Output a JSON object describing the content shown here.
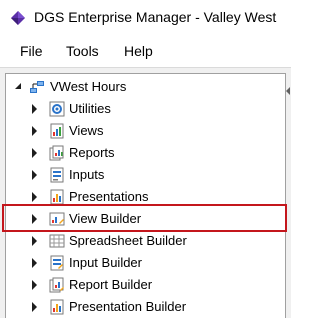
{
  "window": {
    "title": "DGS Enterprise Manager - Valley West",
    "app_icon": "dgs-diamond-logo-icon"
  },
  "menubar": {
    "items": [
      {
        "label": "File"
      },
      {
        "label": "Tools"
      },
      {
        "label": "Help"
      }
    ]
  },
  "tree": {
    "root": {
      "label": "VWest Hours",
      "icon": "network-folder-icon",
      "expanded": true
    },
    "children": [
      {
        "label": "Utilities",
        "icon": "utilities-icon"
      },
      {
        "label": "Views",
        "icon": "views-icon"
      },
      {
        "label": "Reports",
        "icon": "reports-icon"
      },
      {
        "label": "Inputs",
        "icon": "inputs-icon"
      },
      {
        "label": "Presentations",
        "icon": "presentations-icon"
      },
      {
        "label": "View Builder",
        "icon": "view-builder-icon",
        "highlighted": true
      },
      {
        "label": "Spreadsheet Builder",
        "icon": "spreadsheet-builder-icon"
      },
      {
        "label": "Input Builder",
        "icon": "input-builder-icon"
      },
      {
        "label": "Report Builder",
        "icon": "report-builder-icon"
      },
      {
        "label": "Presentation Builder",
        "icon": "presentation-builder-icon"
      }
    ]
  },
  "colors": {
    "highlight_border": "#c4161c",
    "pane_background": "#f0f0f0"
  }
}
